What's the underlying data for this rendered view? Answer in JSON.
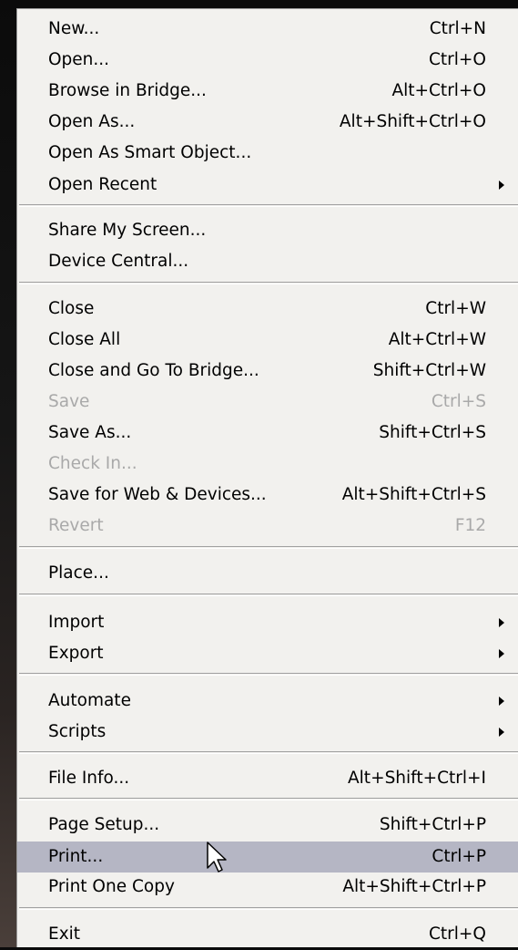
{
  "items": [
    {
      "label": "New...",
      "shortcut": "Ctrl+N",
      "submenu": false,
      "enabled": true
    },
    {
      "label": "Open...",
      "shortcut": "Ctrl+O",
      "submenu": false,
      "enabled": true
    },
    {
      "label": "Browse in Bridge...",
      "shortcut": "Alt+Ctrl+O",
      "submenu": false,
      "enabled": true
    },
    {
      "label": "Open As...",
      "shortcut": "Alt+Shift+Ctrl+O",
      "submenu": false,
      "enabled": true
    },
    {
      "label": "Open As Smart Object...",
      "shortcut": "",
      "submenu": false,
      "enabled": true
    },
    {
      "label": "Open Recent",
      "shortcut": "",
      "submenu": true,
      "enabled": true
    },
    {
      "label": "Share My Screen...",
      "shortcut": "",
      "submenu": false,
      "enabled": true
    },
    {
      "label": "Device Central...",
      "shortcut": "",
      "submenu": false,
      "enabled": true
    },
    {
      "label": "Close",
      "shortcut": "Ctrl+W",
      "submenu": false,
      "enabled": true
    },
    {
      "label": "Close All",
      "shortcut": "Alt+Ctrl+W",
      "submenu": false,
      "enabled": true
    },
    {
      "label": "Close and Go To Bridge...",
      "shortcut": "Shift+Ctrl+W",
      "submenu": false,
      "enabled": true
    },
    {
      "label": "Save",
      "shortcut": "Ctrl+S",
      "submenu": false,
      "enabled": false
    },
    {
      "label": "Save As...",
      "shortcut": "Shift+Ctrl+S",
      "submenu": false,
      "enabled": true
    },
    {
      "label": "Check In...",
      "shortcut": "",
      "submenu": false,
      "enabled": false
    },
    {
      "label": "Save for Web & Devices...",
      "shortcut": "Alt+Shift+Ctrl+S",
      "submenu": false,
      "enabled": true
    },
    {
      "label": "Revert",
      "shortcut": "F12",
      "submenu": false,
      "enabled": false
    },
    {
      "label": "Place...",
      "shortcut": "",
      "submenu": false,
      "enabled": true
    },
    {
      "label": "Import",
      "shortcut": "",
      "submenu": true,
      "enabled": true
    },
    {
      "label": "Export",
      "shortcut": "",
      "submenu": true,
      "enabled": true
    },
    {
      "label": "Automate",
      "shortcut": "",
      "submenu": true,
      "enabled": true
    },
    {
      "label": "Scripts",
      "shortcut": "",
      "submenu": true,
      "enabled": true
    },
    {
      "label": "File Info...",
      "shortcut": "Alt+Shift+Ctrl+I",
      "submenu": false,
      "enabled": true
    },
    {
      "label": "Page Setup...",
      "shortcut": "Shift+Ctrl+P",
      "submenu": false,
      "enabled": true
    },
    {
      "label": "Print...",
      "shortcut": "Ctrl+P",
      "submenu": false,
      "enabled": true,
      "highlighted": true
    },
    {
      "label": "Print One Copy",
      "shortcut": "Alt+Shift+Ctrl+P",
      "submenu": false,
      "enabled": true
    },
    {
      "label": "Exit",
      "shortcut": "Ctrl+Q",
      "submenu": false,
      "enabled": true
    }
  ],
  "colors": {
    "menu_background": "#f2f1ee",
    "highlight": "#b5b6c4",
    "disabled_text": "#a9a9a9"
  }
}
